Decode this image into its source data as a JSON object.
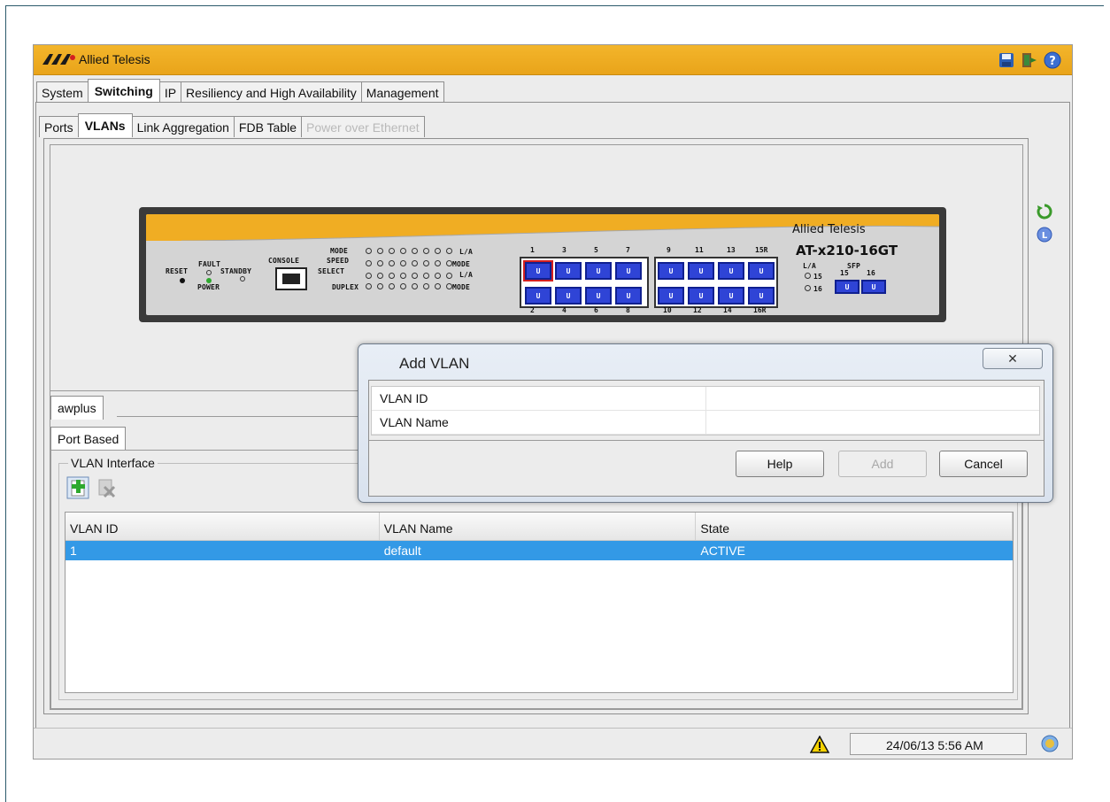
{
  "app": {
    "brand_name": "Allied Telesis",
    "brand_logo_text": "AT"
  },
  "titlebar_icons": [
    "save-icon",
    "exit-icon",
    "help-icon"
  ],
  "main_tabs": [
    {
      "label": "System",
      "active": false
    },
    {
      "label": "Switching",
      "active": true
    },
    {
      "label": "IP",
      "active": false
    },
    {
      "label": "Resiliency and High Availability",
      "active": false
    },
    {
      "label": "Management",
      "active": false
    }
  ],
  "sub_tabs": [
    {
      "label": "Ports",
      "active": false
    },
    {
      "label": "VLANs",
      "active": true
    },
    {
      "label": "Link Aggregation",
      "active": false
    },
    {
      "label": "FDB Table",
      "active": false
    },
    {
      "label": "Power over Ethernet",
      "active": false,
      "disabled": true
    }
  ],
  "device": {
    "brand": "Allied Telesis",
    "model": "AT-x210-16GT",
    "labels": {
      "reset": "RESET",
      "fault": "FAULT",
      "power": "POWER",
      "standby": "STANDBY",
      "console": "CONSOLE",
      "mode": "MODE",
      "speed": "SPEED",
      "select": "SELECT",
      "duplex": "DUPLEX",
      "la": "L/A",
      "sfp": "SFP"
    },
    "top_port_numbers": [
      "1",
      "3",
      "5",
      "7",
      "9",
      "11",
      "13",
      "15R"
    ],
    "bottom_port_numbers": [
      "2",
      "4",
      "6",
      "8",
      "10",
      "12",
      "14",
      "16R"
    ],
    "port_label": "U",
    "sfp_numbers": [
      "15",
      "16"
    ],
    "sfp_led_labels": [
      "15",
      "16"
    ]
  },
  "panel_tabs": {
    "context_tab": "awplus",
    "type_tab": "Port Based"
  },
  "vlan_interface": {
    "legend": "VLAN Interface",
    "toolbar": [
      "add-vlan-icon",
      "delete-vlan-icon"
    ],
    "columns": [
      "VLAN ID",
      "VLAN Name",
      "State"
    ],
    "rows": [
      {
        "id": "1",
        "name": "default",
        "state": "ACTIVE",
        "selected": true
      }
    ]
  },
  "statusbar": {
    "datetime": "24/06/13 5:56 AM"
  },
  "dialog": {
    "title": "Add VLAN",
    "fields": [
      {
        "label": "VLAN ID",
        "value": ""
      },
      {
        "label": "VLAN Name",
        "value": ""
      }
    ],
    "buttons": {
      "help": "Help",
      "add": "Add",
      "cancel": "Cancel"
    }
  },
  "colors": {
    "titlebar": "#f0ad23",
    "selection": "#3399e6",
    "port_blue": "#2f44d6"
  }
}
